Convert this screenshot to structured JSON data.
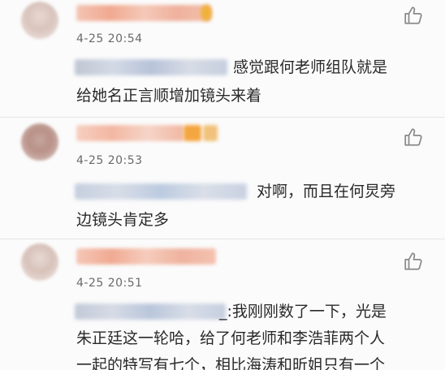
{
  "comments": [
    {
      "time": "4-25 20:54",
      "line1": "感觉跟何老师组队就是",
      "line2": "给她名正言顺增加镜头来着"
    },
    {
      "time": "4-25 20:53",
      "line1": "对啊，而且在何炅旁",
      "line2": "边镜头肯定多"
    },
    {
      "time": "4-25 20:51",
      "line1": "_:我刚刚数了一下，光是",
      "line2": "朱正廷这一轮哈，给了何老师和李浩菲两个人",
      "line3": "一起的特写有七个，相比海涛和昕姐只有一个"
    }
  ],
  "icons": {
    "like": "thumbs-up-icon",
    "avatar": "avatar"
  },
  "colors": {
    "text": "#2a2a2a",
    "time": "#6a6a6a",
    "icon": "#8a8a8a",
    "blur_name": "#f2b49e",
    "blur_reply": "#c8d2e6"
  }
}
